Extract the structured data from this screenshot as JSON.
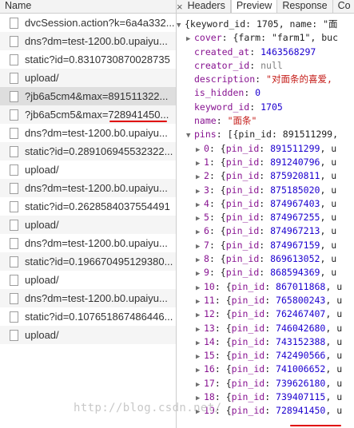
{
  "left_panel": {
    "header": "Name",
    "requests": [
      "dvcSession.action?k=6a4a332...",
      "dns?dm=test-1200.b0.upaiyu...",
      "static?id=0.8310730870028735",
      "upload/",
      "?jb6a5cm4&max=891511322...",
      "?jb6a5cm5&max=728941450...",
      "dns?dm=test-1200.b0.upaiyu...",
      "static?id=0.289106945532322...",
      "upload/",
      "dns?dm=test-1200.b0.upaiyu...",
      "static?id=0.2628584037554491",
      "upload/",
      "dns?dm=test-1200.b0.upaiyu...",
      "static?id=0.196670495129380...",
      "upload/",
      "dns?dm=test-1200.b0.upaiyu...",
      "static?id=0.107651867486446...",
      "upload/"
    ]
  },
  "right_panel": {
    "close_symbol": "×",
    "tabs": [
      "Headers",
      "Preview",
      "Response",
      "Co"
    ],
    "active_tab": "Preview",
    "json_lines": {
      "root": "{keyword_id: 1705, name: \"面",
      "cover_key": "cover",
      "cover_value": "{farm: \"farm1\", buc",
      "created_at_key": "created_at",
      "created_at_value": "1463568297",
      "creator_id_key": "creator_id",
      "creator_id_value": "null",
      "description_key": "description",
      "description_value": "\"对面条的喜爱,",
      "is_hidden_key": "is_hidden",
      "is_hidden_value": "0",
      "keyword_id_key": "keyword_id",
      "keyword_id_value": "1705",
      "name_key": "name",
      "name_value": "\"面条\"",
      "pins_key": "pins",
      "pins_value": "[{pin_id: 891511299,"
    },
    "pins": [
      {
        "index": "0",
        "pin_id": "891511299"
      },
      {
        "index": "1",
        "pin_id": "891240796"
      },
      {
        "index": "2",
        "pin_id": "875920811"
      },
      {
        "index": "3",
        "pin_id": "875185020"
      },
      {
        "index": "4",
        "pin_id": "874967403"
      },
      {
        "index": "5",
        "pin_id": "874967255"
      },
      {
        "index": "6",
        "pin_id": "874967213"
      },
      {
        "index": "7",
        "pin_id": "874967159"
      },
      {
        "index": "8",
        "pin_id": "869613052"
      },
      {
        "index": "9",
        "pin_id": "868594369"
      },
      {
        "index": "10",
        "pin_id": "867011868"
      },
      {
        "index": "11",
        "pin_id": "765800243"
      },
      {
        "index": "12",
        "pin_id": "762467407"
      },
      {
        "index": "13",
        "pin_id": "746042680"
      },
      {
        "index": "14",
        "pin_id": "743152388"
      },
      {
        "index": "15",
        "pin_id": "742490566"
      },
      {
        "index": "16",
        "pin_id": "741006652"
      },
      {
        "index": "17",
        "pin_id": "739626180"
      },
      {
        "index": "18",
        "pin_id": "739407115"
      },
      {
        "index": "19",
        "pin_id": "728941450"
      }
    ]
  },
  "watermark": "http://blog.csdn.net/",
  "colors": {
    "key": "#881391",
    "string": "#c41a16",
    "number": "#1c00cf",
    "annotation": "#e00000"
  }
}
